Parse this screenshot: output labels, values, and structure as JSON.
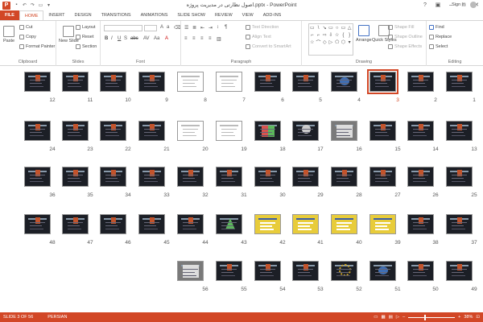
{
  "window": {
    "title": "اصول نظارتی در مدیریت پروژه.pptx - PowerPoint",
    "app_icon": "P",
    "sign_in": "Sign in"
  },
  "tabs": [
    "FILE",
    "HOME",
    "INSERT",
    "DESIGN",
    "TRANSITIONS",
    "ANIMATIONS",
    "SLIDE SHOW",
    "REVIEW",
    "VIEW",
    "ADD-INS"
  ],
  "active_tab": "HOME",
  "ribbon": {
    "clipboard": {
      "label": "Clipboard",
      "paste": "Paste",
      "cut": "Cut",
      "copy": "Copy",
      "format_painter": "Format Painter"
    },
    "slides": {
      "label": "Slides",
      "new_slide": "New Slide",
      "layout": "Layout",
      "reset": "Reset",
      "section": "Section"
    },
    "font": {
      "label": "Font"
    },
    "paragraph": {
      "label": "Paragraph",
      "text_direction": "Text Direction",
      "align_text": "Align Text",
      "convert_smartart": "Convert to SmartArt"
    },
    "drawing": {
      "label": "Drawing",
      "arrange": "Arrange",
      "quick_styles": "Quick Styles",
      "shape_fill": "Shape Fill",
      "shape_outline": "Shape Outline",
      "shape_effects": "Shape Effects"
    },
    "editing": {
      "label": "Editing",
      "find": "Find",
      "replace": "Replace",
      "select": "Select"
    }
  },
  "slides": {
    "selected": "3",
    "rows": [
      [
        "12",
        "11",
        "10",
        "9",
        "8",
        "7",
        "6",
        "5",
        "4",
        "3",
        "2",
        "1"
      ],
      [
        "24",
        "23",
        "22",
        "21",
        "20",
        "19",
        "18",
        "17",
        "16",
        "15",
        "14",
        "13"
      ],
      [
        "36",
        "35",
        "34",
        "33",
        "32",
        "31",
        "30",
        "29",
        "28",
        "27",
        "26",
        "25"
      ],
      [
        "48",
        "47",
        "46",
        "45",
        "44",
        "43",
        "42",
        "41",
        "40",
        "39",
        "38",
        "37"
      ],
      [
        "",
        "",
        "",
        "",
        "56",
        "55",
        "54",
        "53",
        "52",
        "51",
        "50",
        "49"
      ]
    ]
  },
  "status": {
    "slide_info": "SLIDE 3 OF 56",
    "language": "PERSIAN",
    "zoom": "38%",
    "accent": "#d24726"
  }
}
